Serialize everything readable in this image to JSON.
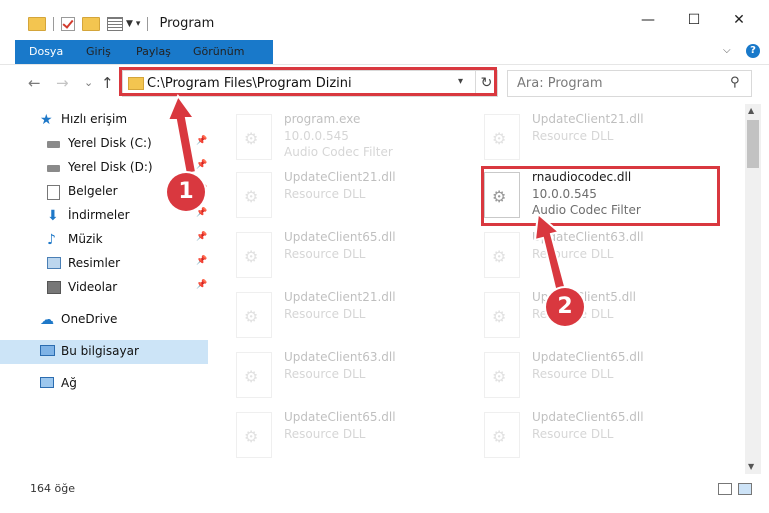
{
  "window": {
    "title": "Program",
    "minimize": "—",
    "maximize": "☐",
    "close": "✕"
  },
  "ribbon": {
    "tabs": [
      "Dosya",
      "Giriş",
      "Paylaş",
      "Görünüm"
    ],
    "help": "?"
  },
  "nav": {
    "back": "←",
    "forward": "→",
    "recent": "⌄",
    "up": "↑",
    "address_path": "C:\\Program Files\\Program Dizini",
    "search_placeholder": "Ara: Program"
  },
  "sidebar": {
    "items": [
      {
        "label": "Hızlı erişim",
        "icon": "star-icon",
        "pinned": false
      },
      {
        "label": "Yerel Disk (C:)",
        "icon": "drive-icon",
        "pinned": true
      },
      {
        "label": "Yerel Disk (D:)",
        "icon": "drive-icon",
        "pinned": true
      },
      {
        "label": "Belgeler",
        "icon": "documents-icon",
        "pinned": true
      },
      {
        "label": "İndirmeler",
        "icon": "download-icon",
        "pinned": true
      },
      {
        "label": "Müzik",
        "icon": "music-icon",
        "pinned": true
      },
      {
        "label": "Resimler",
        "icon": "pictures-icon",
        "pinned": true
      },
      {
        "label": "Videolar",
        "icon": "video-icon",
        "pinned": true
      },
      {
        "label": "OneDrive",
        "icon": "cloud-icon",
        "pinned": false
      },
      {
        "label": "Bu bilgisayar",
        "icon": "computer-icon",
        "pinned": false,
        "selected": true
      },
      {
        "label": "Ağ",
        "icon": "network-icon",
        "pinned": false
      }
    ]
  },
  "files": [
    {
      "name": "program.exe",
      "line2": "10.0.0.545",
      "line3": "Audio Codec Filter",
      "faded": true,
      "col": 0,
      "row": 0
    },
    {
      "name": "UpdateClient21.dll",
      "line2": "Resource DLL",
      "line3": "",
      "faded": true,
      "col": 1,
      "row": 0
    },
    {
      "name": "UpdateClient21.dll",
      "line2": "Resource DLL",
      "line3": "",
      "faded": true,
      "col": 0,
      "row": 1
    },
    {
      "name": "rnaudiocodec.dll",
      "line2": "10.0.0.545",
      "line3": "Audio Codec Filter",
      "faded": false,
      "col": 1,
      "row": 1
    },
    {
      "name": "UpdateClient65.dll",
      "line2": "Resource DLL",
      "line3": "",
      "faded": true,
      "col": 0,
      "row": 2
    },
    {
      "name": "UpdateClient63.dll",
      "line2": "Resource DLL",
      "line3": "",
      "faded": true,
      "col": 1,
      "row": 2
    },
    {
      "name": "UpdateClient21.dll",
      "line2": "Resource DLL",
      "line3": "",
      "faded": true,
      "col": 0,
      "row": 3
    },
    {
      "name": "UpdateClient5.dll",
      "line2": "Resource DLL",
      "line3": "",
      "faded": true,
      "col": 1,
      "row": 3
    },
    {
      "name": "UpdateClient63.dll",
      "line2": "Resource DLL",
      "line3": "",
      "faded": true,
      "col": 0,
      "row": 4
    },
    {
      "name": "UpdateClient65.dll",
      "line2": "Resource DLL",
      "line3": "",
      "faded": true,
      "col": 1,
      "row": 4
    },
    {
      "name": "UpdateClient65.dll",
      "line2": "Resource DLL",
      "line3": "",
      "faded": true,
      "col": 0,
      "row": 5
    },
    {
      "name": "UpdateClient65.dll",
      "line2": "Resource DLL",
      "line3": "",
      "faded": true,
      "col": 1,
      "row": 5
    }
  ],
  "status": {
    "item_count": "164 öğe"
  },
  "annotations": {
    "badge1": "1",
    "badge2": "2",
    "color": "#d9383f"
  }
}
